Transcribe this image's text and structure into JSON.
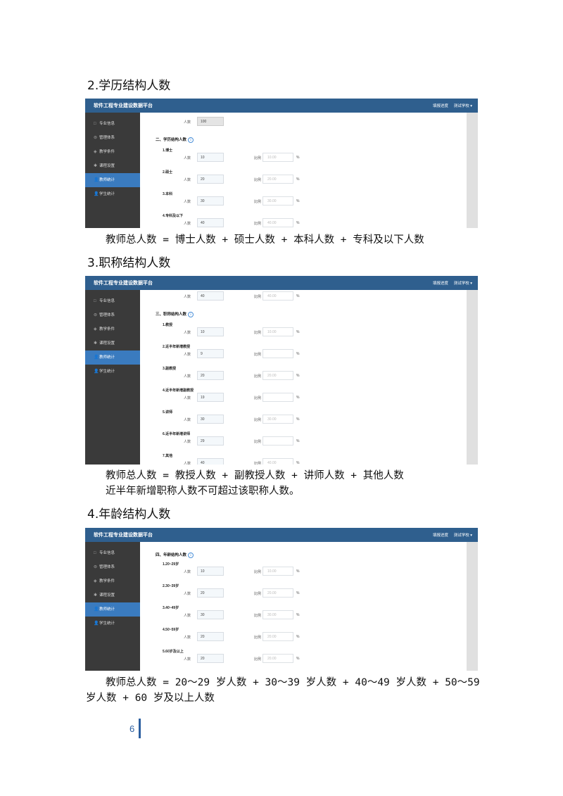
{
  "headings": {
    "h2": "2.学历结构人数",
    "h3": "3.职称结构人数",
    "h4": "4.年龄结构人数"
  },
  "app": {
    "brand": "软件工程专业建设数据平台",
    "progress_link": "填报进度",
    "user_menu": "测试学校 ▾",
    "sidebar": [
      {
        "icon": "□",
        "label": "专业信息"
      },
      {
        "icon": "⊜",
        "label": "管理体系"
      },
      {
        "icon": "◈",
        "label": "教学条件"
      },
      {
        "icon": "✱",
        "label": "课程设置"
      },
      {
        "icon": "👤",
        "label": "教师统计",
        "active": true
      },
      {
        "icon": "👤",
        "label": "学生统计"
      }
    ],
    "label_count": "人数",
    "label_ratio": "比例",
    "pct_sign": "%"
  },
  "shot1": {
    "top_count": "100",
    "section_title": "二、学历结构人数",
    "rows": [
      {
        "title": "1.博士",
        "count": "10",
        "ratio": "10.00"
      },
      {
        "title": "2.硕士",
        "count": "20",
        "ratio": "20.00"
      },
      {
        "title": "3.本科",
        "count": "30",
        "ratio": "30.00"
      },
      {
        "title": "4.专科及以下",
        "count": "40",
        "ratio": "40.00"
      }
    ]
  },
  "caption1": "教师总人数 = 博士人数 + 硕士人数 + 本科人数 + 专科及以下人数",
  "shot2": {
    "top_count": "40",
    "top_ratio": "40.00",
    "section_title": "三、职称结构人数",
    "rows": [
      {
        "title": "1.教授",
        "count": "10",
        "ratio": "10.00"
      },
      {
        "title": "2.近半年新增教授",
        "count": "9",
        "ratio": ""
      },
      {
        "title": "3.副教授",
        "count": "20",
        "ratio": "20.00"
      },
      {
        "title": "4.近半年新增副教授",
        "count": "19",
        "ratio": ""
      },
      {
        "title": "5.讲师",
        "count": "30",
        "ratio": "30.00"
      },
      {
        "title": "6.近半年新增讲师",
        "count": "29",
        "ratio": ""
      },
      {
        "title": "7.其他",
        "count": "40",
        "ratio": "40.00"
      }
    ]
  },
  "caption2a": "教师总人数 = 教授人数 + 副教授人数 + 讲师人数 + 其他人数",
  "caption2b": "近半年新增职称人数不可超过该职称人数。",
  "shot3": {
    "section_title": "四、年龄结构人数",
    "rows": [
      {
        "title": "1.20~29岁",
        "count": "10",
        "ratio": "10.00"
      },
      {
        "title": "2.30~39岁",
        "count": "20",
        "ratio": "20.00"
      },
      {
        "title": "3.40~49岁",
        "count": "30",
        "ratio": "30.00"
      },
      {
        "title": "4.50~59岁",
        "count": "20",
        "ratio": "20.00"
      },
      {
        "title": "5.60岁及以上",
        "count": "20",
        "ratio": "20.00"
      }
    ]
  },
  "caption3a": "教师总人数 = 20～29 岁人数 + 30～39 岁人数 + 40～49 岁人数 + 50～59",
  "caption3b": "岁人数 + 60 岁及以上人数",
  "page_number": "6"
}
